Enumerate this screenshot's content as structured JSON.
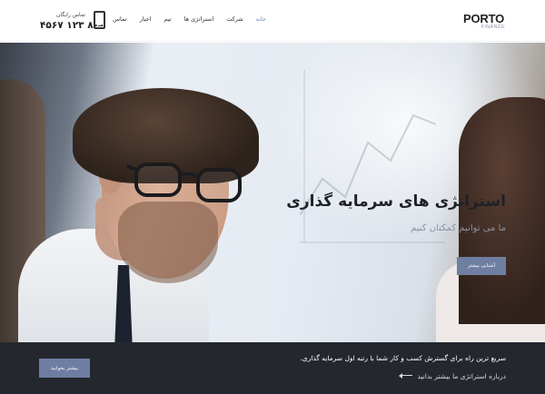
{
  "header": {
    "logo": {
      "text": "PORTO",
      "sub": "FINANCE"
    },
    "nav": [
      {
        "label": "خانه",
        "active": true
      },
      {
        "label": "شرکت",
        "active": false
      },
      {
        "label": "استراتژی ها",
        "active": false
      },
      {
        "label": "تیم",
        "active": false
      },
      {
        "label": "اخبار",
        "active": false
      },
      {
        "label": "تماس",
        "active": false
      }
    ],
    "free_call_label": "تماس رایگان",
    "phone_number": "۸۰۰ ۱۲۳ ۴۵۶۷",
    "phone_icon": "phone-icon"
  },
  "hero": {
    "title": "استراتژی های سرمایه گذاری",
    "subtitle": "ما می توانیم کمکتان کنیم",
    "button_label": "آشنایی بیشتر"
  },
  "bottom_bar": {
    "text": "سریع ترین راه برای گسترش کسب و کار شما با رتبه اول سرمایه گذاری.",
    "link_text": "درباره استراتژی ما بیشتر بدانید",
    "button_label": "بیشتر بخوانید"
  },
  "colors": {
    "accent": "#6f86b9",
    "button": "#6f7fa1",
    "bottom_bar": "#25272e"
  }
}
